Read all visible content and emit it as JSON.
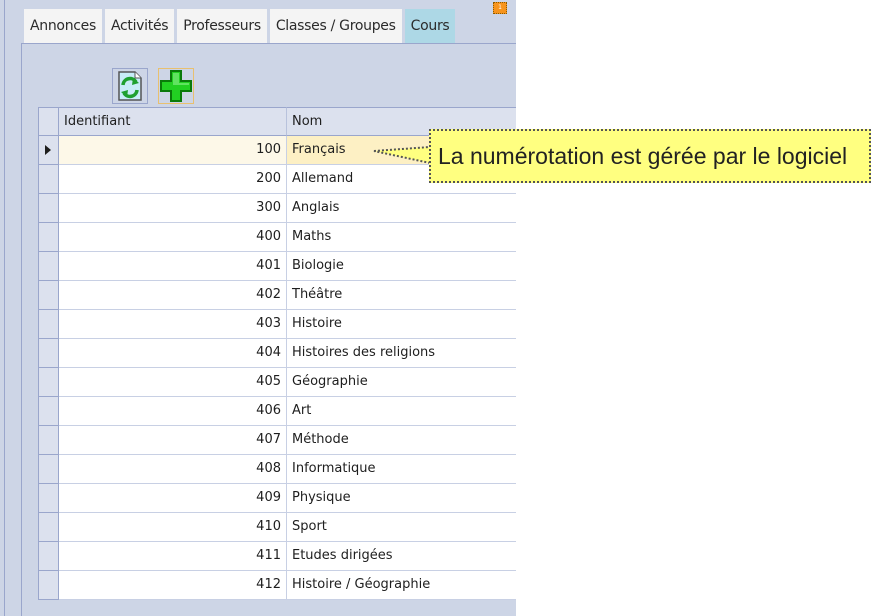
{
  "tabs": [
    {
      "label": "Annonces",
      "active": false
    },
    {
      "label": "Activités",
      "active": false
    },
    {
      "label": "Professeurs",
      "active": false
    },
    {
      "label": "Classes / Groupes",
      "active": false
    },
    {
      "label": "Cours",
      "active": true
    }
  ],
  "notification_badge": "1",
  "toolbar": {
    "refresh_icon": "refresh-icon",
    "add_icon": "add-plus-icon"
  },
  "grid": {
    "columns": [
      "Identifiant",
      "Nom"
    ],
    "selected_row": 0,
    "rows": [
      {
        "id": "100",
        "name": "Français"
      },
      {
        "id": "200",
        "name": "Allemand"
      },
      {
        "id": "300",
        "name": "Anglais"
      },
      {
        "id": "400",
        "name": "Maths"
      },
      {
        "id": "401",
        "name": "Biologie"
      },
      {
        "id": "402",
        "name": "Théâtre"
      },
      {
        "id": "403",
        "name": "Histoire"
      },
      {
        "id": "404",
        "name": "Histoires des religions"
      },
      {
        "id": "405",
        "name": "Géographie"
      },
      {
        "id": "406",
        "name": "Art"
      },
      {
        "id": "407",
        "name": "Méthode"
      },
      {
        "id": "408",
        "name": "Informatique"
      },
      {
        "id": "409",
        "name": "Physique"
      },
      {
        "id": "410",
        "name": "Sport"
      },
      {
        "id": "411",
        "name": "Etudes dirigées"
      },
      {
        "id": "412",
        "name": "Histoire / Géographie"
      }
    ]
  },
  "callout": {
    "text": "La numérotation est gérée par le logiciel",
    "background": "#ffff80"
  },
  "colors": {
    "active_tab": "#add8e6",
    "panel_background": "#cdd5e6",
    "selected_row": "#fdf0c4",
    "badge": "#f7941d",
    "add_icon": "#1ec81e"
  }
}
